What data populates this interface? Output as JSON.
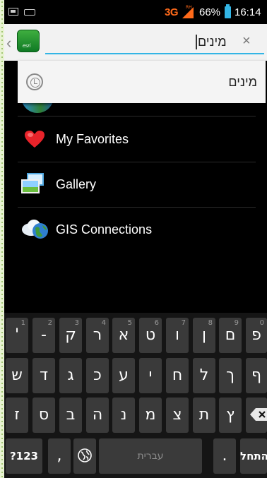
{
  "status_bar": {
    "network": "3G",
    "signal_tag": "RH",
    "battery_percent": "66%",
    "time": "16:14"
  },
  "app_bar": {
    "app_logo_text": "esri",
    "search_query": "מינים",
    "clear_symbol": "×",
    "back_symbol": "‹"
  },
  "suggestion": {
    "text": "מינים"
  },
  "list": {
    "items": [
      {
        "label": "My Favorites",
        "icon": "heart-icon"
      },
      {
        "label": "Gallery",
        "icon": "gallery-icon"
      },
      {
        "label": "GIS Connections",
        "icon": "cloud-globe-icon"
      }
    ]
  },
  "keyboard": {
    "row1": [
      {
        "char": "'",
        "hint": "1"
      },
      {
        "char": "-",
        "hint": "2"
      },
      {
        "char": "ק",
        "hint": "3"
      },
      {
        "char": "ר",
        "hint": "4"
      },
      {
        "char": "א",
        "hint": "5"
      },
      {
        "char": "ט",
        "hint": "6"
      },
      {
        "char": "ו",
        "hint": "7"
      },
      {
        "char": "ן",
        "hint": "8"
      },
      {
        "char": "ם",
        "hint": "9"
      },
      {
        "char": "פ",
        "hint": "0"
      }
    ],
    "row2": [
      "ש",
      "ד",
      "ג",
      "כ",
      "ע",
      "י",
      "ח",
      "ל",
      "ך",
      "ף"
    ],
    "row3": [
      "ז",
      "ס",
      "ב",
      "ה",
      "נ",
      "מ",
      "צ",
      "ת",
      "ץ"
    ],
    "symbols_key": "?123",
    "comma_key": ",",
    "space_label": "עברית",
    "period_key": ".",
    "enter_key": "התחל"
  }
}
